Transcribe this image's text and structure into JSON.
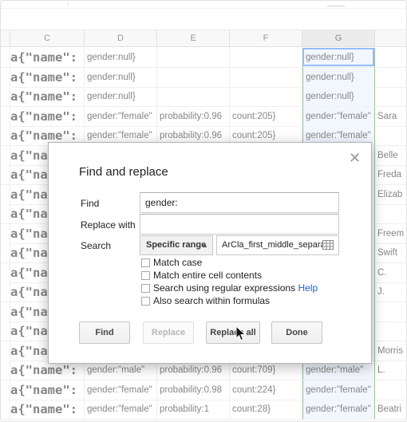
{
  "columns": [
    "C",
    "D",
    "E",
    "F",
    "G"
  ],
  "rows": [
    {
      "c": "a{\"name\":",
      "d": "gender:null}",
      "e": "",
      "f": "",
      "g": "gender:null}",
      "h": ""
    },
    {
      "c": "a{\"name\":",
      "d": "gender:null}",
      "e": "",
      "f": "",
      "g": "gender:null}",
      "h": ""
    },
    {
      "c": "a{\"name\":",
      "d": "gender:null}",
      "e": "",
      "f": "",
      "g": "gender:null}",
      "h": ""
    },
    {
      "c": "a{\"name\":",
      "d": "gender:\"female\"",
      "e": "probability:0.96",
      "f": "count:205}",
      "g": "gender:\"female\"",
      "h": "Sara"
    },
    {
      "c": "a{\"name\":",
      "d": "gender:\"female\"",
      "e": "probability:0.96",
      "f": "count:205}",
      "g": "gender:\"female\"",
      "h": ""
    },
    {
      "c": "a{\"name\":",
      "d": "",
      "e": "",
      "f": "",
      "g": "",
      "h": "Belle"
    },
    {
      "c": "a{\"name\":",
      "d": "",
      "e": "",
      "f": "",
      "g": "",
      "h": "Freda"
    },
    {
      "c": "a{\"name\":",
      "d": "",
      "e": "",
      "f": "",
      "g": "",
      "h": "Elizab"
    },
    {
      "c": "a{\"name\":",
      "d": "",
      "e": "",
      "f": "",
      "g": "",
      "h": ""
    },
    {
      "c": "a{\"name\":",
      "d": "",
      "e": "",
      "f": "",
      "g": "",
      "h": "Freem"
    },
    {
      "c": "a{\"name\":",
      "d": "",
      "e": "",
      "f": "",
      "g": "",
      "h": "Swift"
    },
    {
      "c": "a{\"name\":",
      "d": "",
      "e": "",
      "f": "",
      "g": "",
      "h": "C."
    },
    {
      "c": "a{\"name\":",
      "d": "",
      "e": "",
      "f": "",
      "g": "",
      "h": "J."
    },
    {
      "c": "a{\"name\":",
      "d": "",
      "e": "",
      "f": "",
      "g": "",
      "h": ""
    },
    {
      "c": "a{\"name\":",
      "d": "",
      "e": "",
      "f": "",
      "g": "",
      "h": ""
    },
    {
      "c": "a{\"name\":",
      "d": "",
      "e": "",
      "f": "",
      "g": "",
      "h": "Morris"
    },
    {
      "c": "a{\"name\":",
      "d": "gender:\"male\"",
      "e": "probability:0.96",
      "f": "count:709}",
      "g": "gender:\"male\"",
      "h": "L."
    },
    {
      "c": "a{\"name\":",
      "d": "gender:\"female\"",
      "e": "probability:0.98",
      "f": "count:224}",
      "g": "gender:\"female\"",
      "h": ""
    },
    {
      "c": "a{\"name\":",
      "d": "gender:\"female\"",
      "e": "probability:1",
      "f": "count:28}",
      "g": "gender:\"female\"",
      "h": "Beatri"
    }
  ],
  "dialog": {
    "title": "Find and replace",
    "close_icon": "close-icon",
    "find_label": "Find",
    "find_value": "gender:",
    "replace_label": "Replace with",
    "replace_value": "",
    "search_label": "Search",
    "search_scope": "Specific range",
    "range_value": "ArCla_first_middle_separa",
    "options": [
      {
        "label": "Match case",
        "checked": false
      },
      {
        "label": "Match entire cell contents",
        "checked": false
      },
      {
        "label": "Search using regular expressions",
        "checked": false,
        "link": "Help"
      },
      {
        "label": "Also search within formulas",
        "checked": false
      }
    ],
    "buttons": {
      "find": "Find",
      "replace": "Replace",
      "replace_all": "Replace all",
      "done": "Done"
    }
  },
  "colors": {
    "selected_column_fill": "#e8f0fe",
    "active_cell_border": "#4285f4",
    "help_link": "#1a5fd0"
  }
}
